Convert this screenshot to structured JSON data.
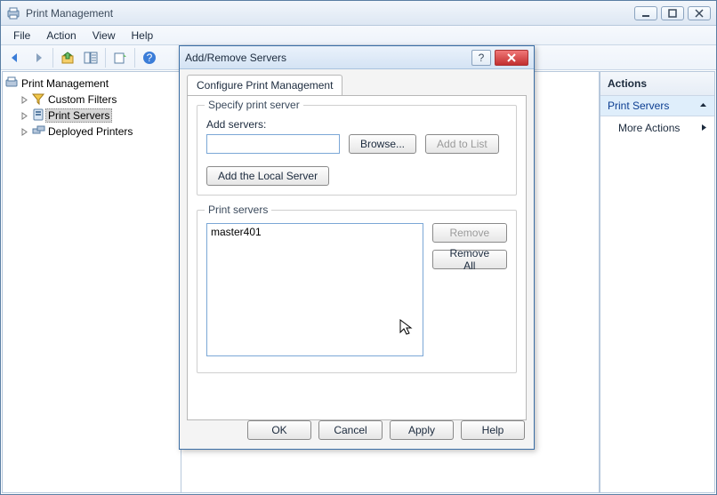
{
  "window": {
    "title": "Print Management"
  },
  "menu": {
    "file": "File",
    "action": "Action",
    "view": "View",
    "help": "Help"
  },
  "tree": {
    "root": "Print Management",
    "custom_filters": "Custom Filters",
    "print_servers": "Print Servers",
    "deployed_printers": "Deployed Printers"
  },
  "actions": {
    "header": "Actions",
    "section": "Print Servers",
    "more": "More Actions"
  },
  "dialog": {
    "title": "Add/Remove Servers",
    "tab": "Configure Print Management",
    "group_specify": "Specify print server",
    "add_servers_label": "Add servers:",
    "add_servers_value": "",
    "browse": "Browse...",
    "add_to_list": "Add to List",
    "add_local": "Add the Local Server",
    "group_list": "Print servers",
    "servers": [
      "master401"
    ],
    "remove": "Remove",
    "remove_all": "Remove All",
    "ok": "OK",
    "cancel": "Cancel",
    "apply": "Apply",
    "help": "Help"
  }
}
